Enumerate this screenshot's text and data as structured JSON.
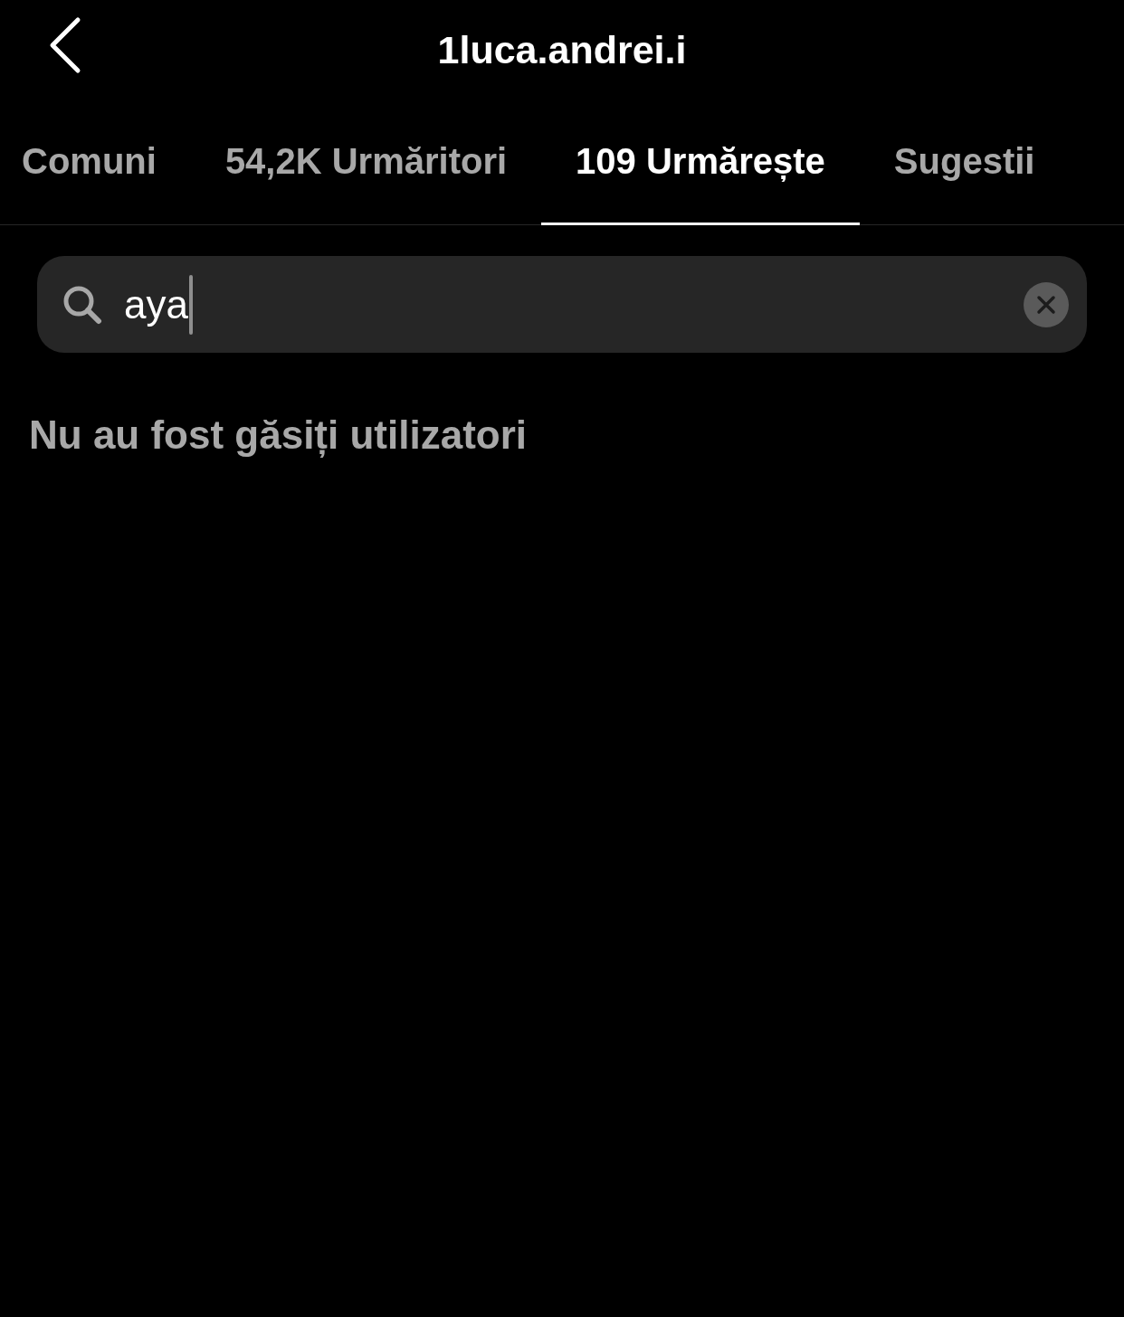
{
  "header": {
    "title": "1luca.andrei.i"
  },
  "tabs": [
    {
      "label": "Comuni",
      "selected": false
    },
    {
      "label": "54,2K Urmăritori",
      "selected": false
    },
    {
      "label": "109 Urmărește",
      "selected": true
    },
    {
      "label": "Sugestii",
      "selected": false
    }
  ],
  "search": {
    "value": "aya"
  },
  "empty_message": "Nu au fost găsiți utilizatori"
}
